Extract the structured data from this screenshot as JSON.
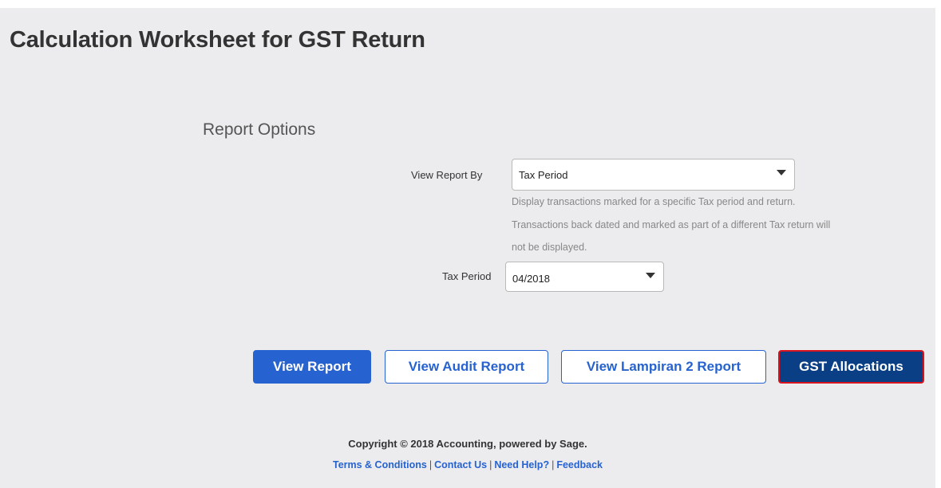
{
  "page": {
    "title": "Calculation Worksheet for GST Return"
  },
  "report_options": {
    "heading": "Report Options",
    "view_report_by": {
      "label": "View Report By",
      "value": "Tax Period",
      "help_lines": [
        "Display transactions marked for a specific Tax period and return.",
        "Transactions back dated and marked as part of a different Tax return will",
        "not be displayed."
      ]
    },
    "tax_period": {
      "label": "Tax Period",
      "value": "04/2018"
    }
  },
  "actions": {
    "view_report": "View Report",
    "view_audit_report": "View Audit Report",
    "view_lampiran_report": "View Lampiran 2 Report",
    "gst_allocations": "GST Allocations"
  },
  "footer": {
    "copyright": "Copyright © 2018 Accounting, powered by Sage.",
    "links": {
      "terms": "Terms & Conditions",
      "contact": "Contact Us",
      "help": "Need Help?",
      "feedback": "Feedback"
    },
    "separator": "|"
  },
  "colors": {
    "panel_background": "#ececee",
    "primary_button": "#2763d0",
    "dark_button": "#0a3f86",
    "highlight_border": "#d9141e",
    "link": "#2763d0"
  }
}
